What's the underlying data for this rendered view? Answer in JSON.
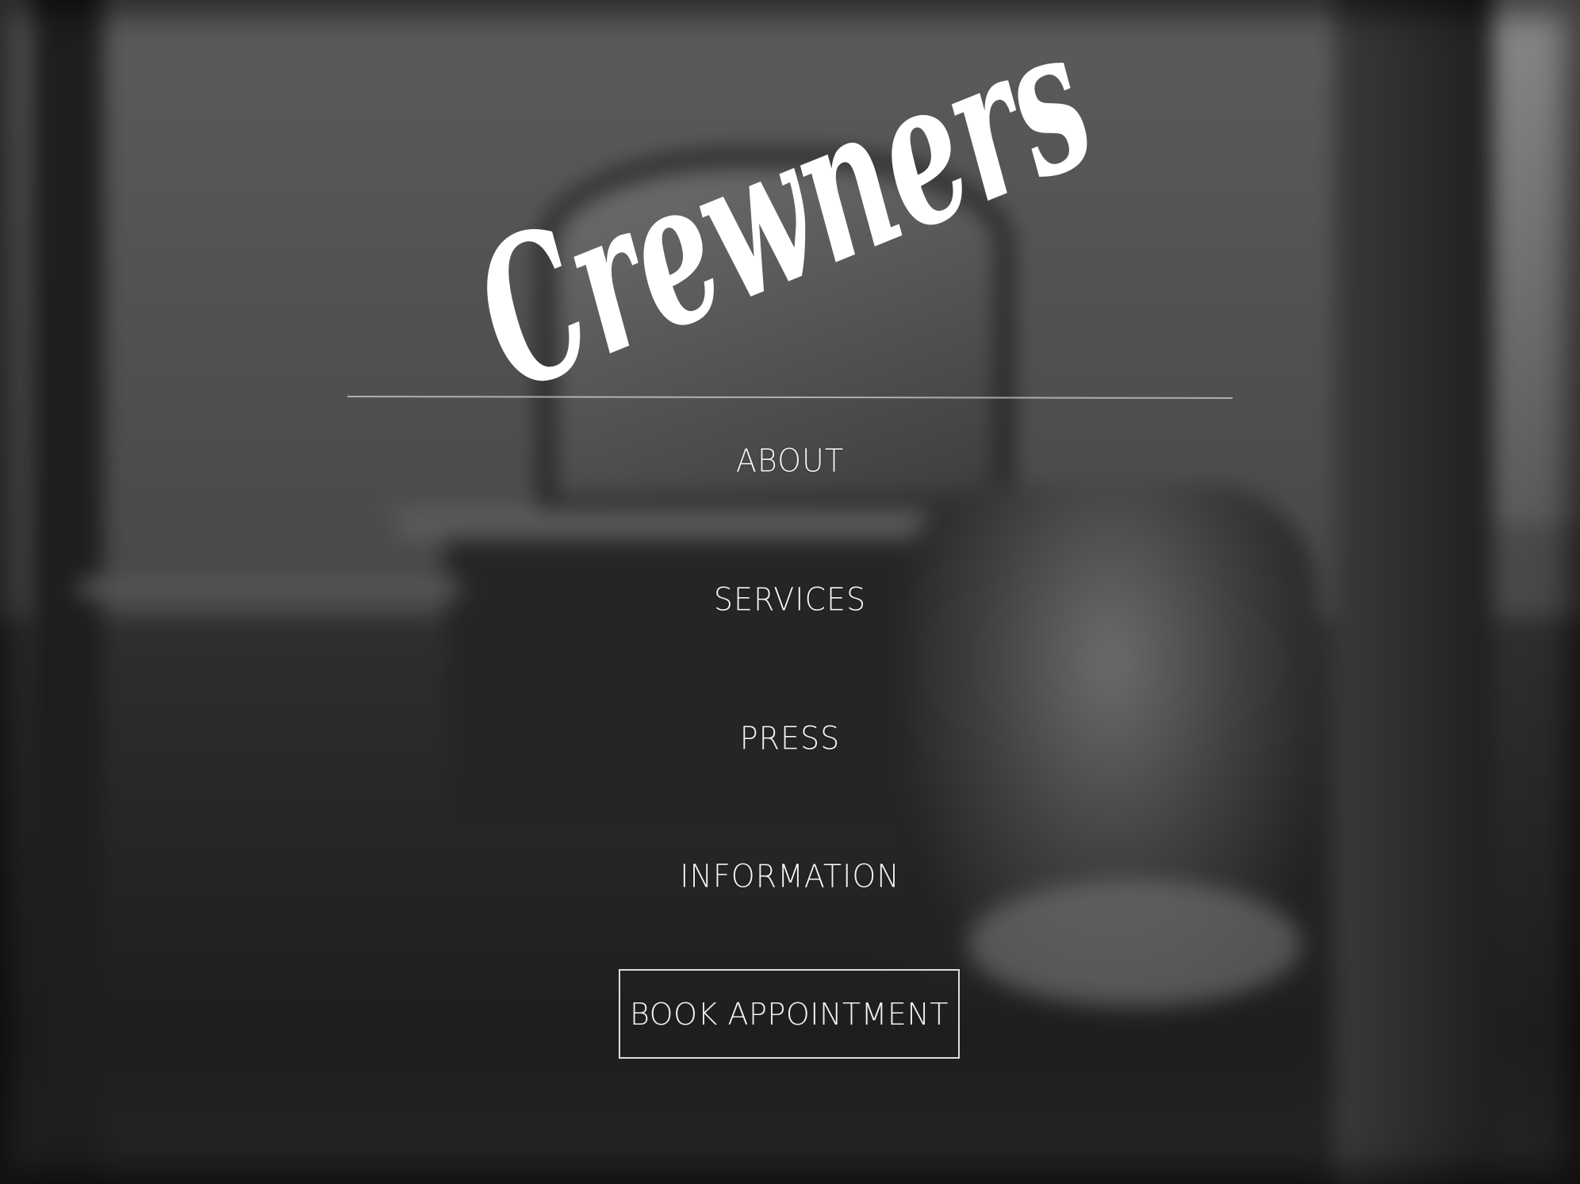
{
  "brand": {
    "logo_text": "Crewners"
  },
  "nav": {
    "items": [
      {
        "label": "ABOUT"
      },
      {
        "label": "SERVICES"
      },
      {
        "label": "PRESS"
      },
      {
        "label": "INFORMATION"
      }
    ]
  },
  "cta": {
    "book_label": "BOOK APPOINTMENT"
  },
  "colors": {
    "text": "#ffffff",
    "background": "#2b2b2b"
  }
}
